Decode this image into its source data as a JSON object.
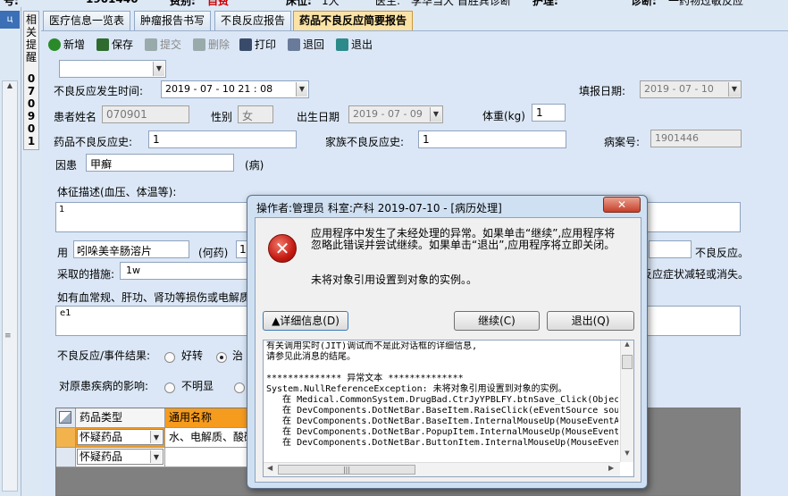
{
  "top_bar": {
    "patient_id_label": "号:",
    "patient_id": "1901446",
    "charge_label": "费别:",
    "charge": "自费",
    "bed_label": "床位:",
    "bed": "1大",
    "doctor_label": "医生:",
    "doctor": "李华当大 首胜宾诊断",
    "nurse_label": "护理:",
    "diag_label": "诊断:",
    "diag": "一药物过敏反应"
  },
  "side_tab": {
    "label": "相关提醒",
    "id_chars": [
      "0",
      "7",
      "0",
      "9",
      "0",
      "1"
    ]
  },
  "tabs": [
    {
      "label": "医疗信息一览表",
      "active": false
    },
    {
      "label": "肿瘤报告书写",
      "active": false
    },
    {
      "label": "不良反应报告",
      "active": false
    },
    {
      "label": "药品不良反应简要报告",
      "active": true
    }
  ],
  "toolbar": [
    {
      "label": "新增",
      "icon": "plus-circle-icon",
      "color": "#2a8a2a"
    },
    {
      "label": "保存",
      "icon": "save-icon",
      "color": "#2f6b2f"
    },
    {
      "label": "提交",
      "icon": "submit-icon",
      "color": "#9aa"
    },
    {
      "label": "删除",
      "icon": "delete-icon",
      "color": "#9aa"
    },
    {
      "label": "打印",
      "icon": "printer-icon",
      "color": "#3a4a6a"
    },
    {
      "label": "退回",
      "icon": "return-icon",
      "color": "#6a7a9a"
    },
    {
      "label": "退出",
      "icon": "exit-icon",
      "color": "#2c8a8a"
    }
  ],
  "form": {
    "occur_label": "不良反应发生时间:",
    "occur_value": "2019 - 07 - 10   21 : 08",
    "report_date_label": "填报日期:",
    "report_date": "2019 - 07 - 10",
    "patient_label": "患者姓名",
    "patient_name": "070901",
    "gender_label": "性别",
    "gender": "女",
    "birth_label": "出生日期",
    "birth": "2019 - 07 - 09",
    "weight_label": "体重(kg)",
    "weight": "1",
    "drug_hist_label": "药品不良反应史:",
    "drug_hist": "1",
    "family_hist_label": "家族不良反应史:",
    "family_hist": "1",
    "case_label": "病案号:",
    "case_no": "1901446",
    "cause_label": "因患",
    "cause": "甲癣",
    "cause_suffix": "(病)",
    "symptom_label": "体征描述(血压、体温等):",
    "symptom": "1",
    "use_label": "用",
    "use_drug": "吲哚美辛肠溶片",
    "use_mid": "(何药)",
    "use_val": "1",
    "adverse_suffix": "不良反应。",
    "measure_label": "采取的措施:",
    "measure": "1w",
    "measure_suffix": "反应症状减轻或消失。",
    "lab_label": "如有血常规、肝功、肾功等损伤或电解质",
    "lab": "e1",
    "result_label": "不良反应/事件结果:",
    "result_opt1": "好转",
    "result_opt2": "治",
    "impact_label": "对原患疾病的影响:",
    "impact_opt1": "不明显"
  },
  "grid": {
    "headers": [
      "药品类型",
      "通用名称"
    ],
    "rows": [
      {
        "type": "怀疑药品",
        "name": "水、电解质、酸碱"
      },
      {
        "type": "怀疑药品",
        "name": ""
      }
    ]
  },
  "dialog": {
    "title": "操作者:管理员 科室:产科 2019-07-10 - [病历处理]",
    "message": "应用程序中发生了未经处理的异常。如果单击“继续”,应用程序将忽略此错误并尝试继续。如果单击“退出”,应用程序将立即关闭。",
    "detail": "未将对象引用设置到对象的实例。。",
    "details_button": "▲详细信息(D)",
    "continue_button": "继续(C)",
    "quit_button": "退出(Q)",
    "trace": [
      "有关调用实时(JIT)调试而不是此对话框的详细信息,",
      "请参见此消息的结尾。",
      "",
      "************** 异常文本 **************",
      "System.NullReferenceException: 未将对象引用设置到对象的实例。",
      "   在 Medical.CommonSystem.DrugBad.CtrJyYPBLFY.btnSave_Click(Objec",
      "   在 DevComponents.DotNetBar.BaseItem.RaiseClick(eEventSource sou",
      "   在 DevComponents.DotNetBar.BaseItem.InternalMouseUp(MouseEventA",
      "   在 DevComponents.DotNetBar.PopupItem.InternalMouseUp(MouseEvent",
      "   在 DevComponents.DotNetBar.ButtonItem.InternalMouseUp(MouseEven"
    ]
  }
}
